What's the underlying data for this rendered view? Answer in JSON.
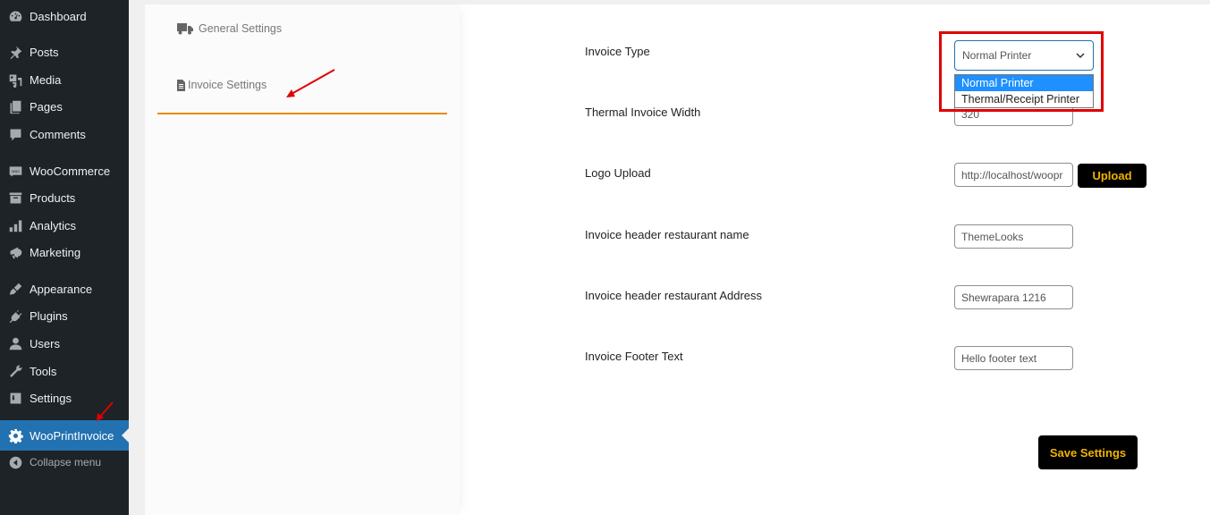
{
  "sidebar": {
    "items": [
      {
        "label": "Dashboard",
        "icon": "dashboard-icon"
      },
      {
        "label": "Posts",
        "icon": "pin-icon"
      },
      {
        "label": "Media",
        "icon": "media-icon"
      },
      {
        "label": "Pages",
        "icon": "pages-icon"
      },
      {
        "label": "Comments",
        "icon": "comment-icon"
      },
      {
        "label": "WooCommerce",
        "icon": "woo-icon"
      },
      {
        "label": "Products",
        "icon": "archive-icon"
      },
      {
        "label": "Analytics",
        "icon": "bar-chart-icon"
      },
      {
        "label": "Marketing",
        "icon": "megaphone-icon"
      },
      {
        "label": "Appearance",
        "icon": "brush-icon"
      },
      {
        "label": "Plugins",
        "icon": "plug-icon"
      },
      {
        "label": "Users",
        "icon": "user-icon"
      },
      {
        "label": "Tools",
        "icon": "wrench-icon"
      },
      {
        "label": "Settings",
        "icon": "settings-sliders-icon"
      },
      {
        "label": "WooPrintInvoice",
        "icon": "gear-icon",
        "current": true
      },
      {
        "label": "Collapse menu",
        "icon": "collapse-icon"
      }
    ]
  },
  "tabs": [
    {
      "label": "General Settings",
      "icon": "truck-icon"
    },
    {
      "label": "Invoice Settings",
      "icon": "document-icon",
      "active": true
    }
  ],
  "form": {
    "invoice_type": {
      "label": "Invoice Type",
      "value": "Normal Printer",
      "options": [
        "Normal Printer",
        "Thermal/Receipt Printer"
      ],
      "highlighted_option": "Normal Printer"
    },
    "thermal_width": {
      "label": "Thermal Invoice Width",
      "value": "320"
    },
    "logo_upload": {
      "label": "Logo Upload",
      "value": "http://localhost/woopr",
      "button": "Upload"
    },
    "restaurant_name": {
      "label": "Invoice header restaurant name",
      "value": "ThemeLooks"
    },
    "restaurant_address": {
      "label": "Invoice header restaurant Address",
      "value": "Shewrapara 1216"
    },
    "footer_text": {
      "label": "Invoice Footer Text",
      "value": "Hello footer text"
    },
    "save_button": "Save Settings"
  },
  "colors": {
    "sidebar_bg": "#1d2327",
    "sidebar_current": "#2271b1",
    "tab_accent": "#e98b00",
    "button_bg": "#000000",
    "button_text": "#f0b400",
    "annotation": "#e00000"
  }
}
